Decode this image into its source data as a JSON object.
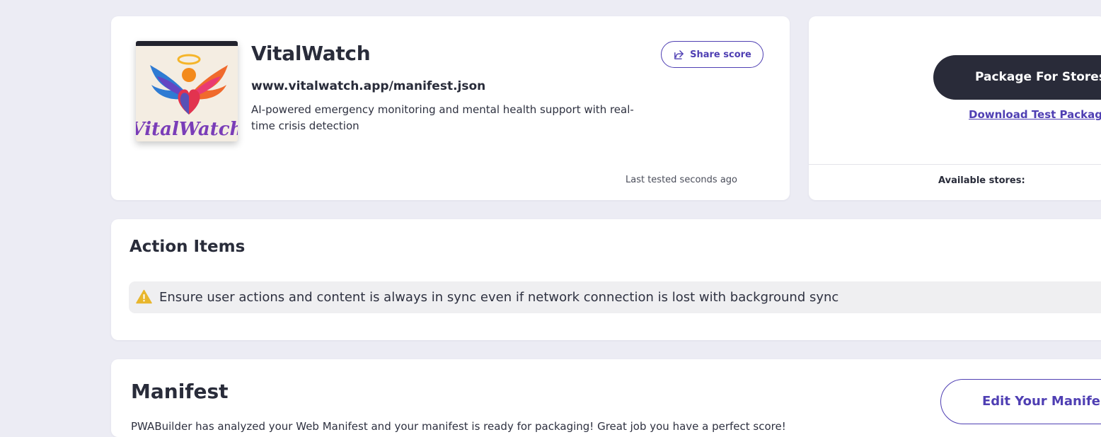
{
  "app": {
    "name": "VitalWatch",
    "manifest_url": "www.vitalwatch.app/manifest.json",
    "description": "AI-powered emergency monitoring and mental health support with real-time crisis detection",
    "last_tested": "Last tested seconds ago",
    "share_label": "Share score",
    "icon_text": "VitalWatch"
  },
  "package": {
    "primary_label": "Package For Stores",
    "download_label": "Download Test Package",
    "stores_label": "Available stores:"
  },
  "action_items": {
    "title": "Action Items",
    "items": [
      {
        "icon": "warning-icon",
        "text": "Ensure user actions and content is always in sync even if network connection is lost with background sync"
      }
    ]
  },
  "manifest": {
    "title": "Manifest",
    "description": "PWABuilder has analyzed your Web Manifest and your manifest is ready for packaging! Great job you have a perfect score!",
    "edit_label": "Edit Your Manifest"
  },
  "colors": {
    "background": "#ececf4",
    "card": "#ffffff",
    "accent": "#4f3fb3",
    "primary_button": "#292b39",
    "warning": "#e8b62c"
  }
}
